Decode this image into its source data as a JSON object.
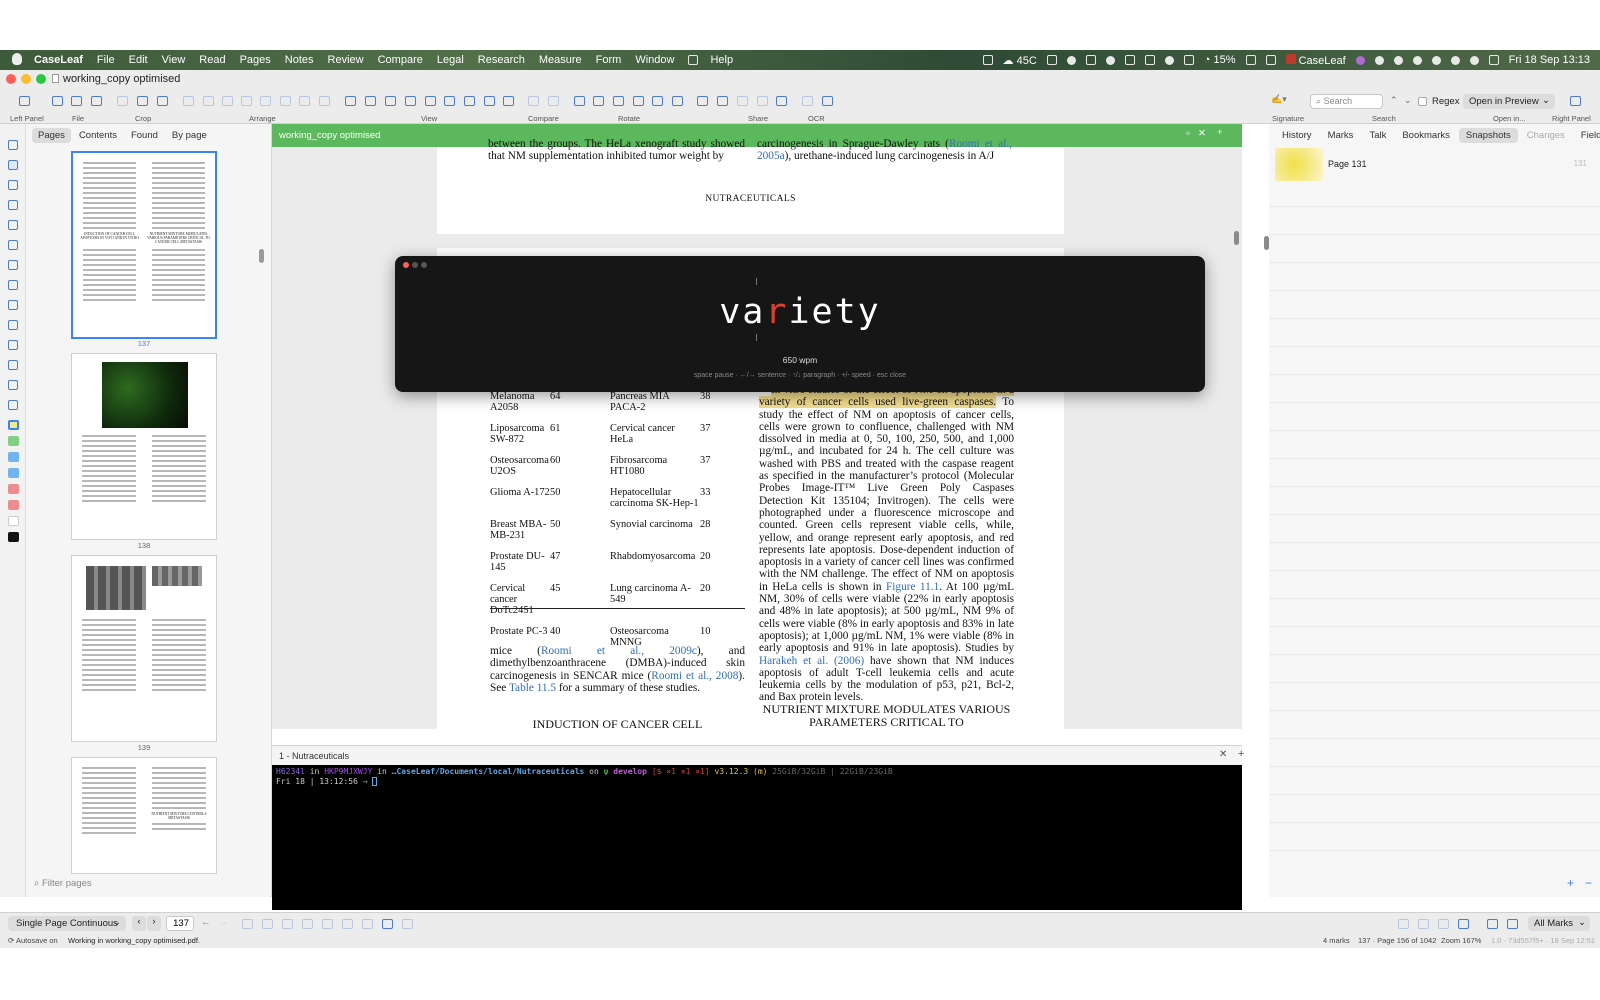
{
  "menubar": {
    "app_name": "CaseLeaf",
    "items": [
      "File",
      "Edit",
      "View",
      "Read",
      "Pages",
      "Notes",
      "Review",
      "Compare",
      "Legal",
      "Research",
      "Measure",
      "Form",
      "Window",
      "Help"
    ],
    "temperature": "45C",
    "battery": "15%",
    "active_app": "CaseLeaf",
    "clock": "Fri 18 Sep  13:13"
  },
  "window": {
    "title": "working_copy optimised"
  },
  "toolbar": {
    "groups": [
      "Left Panel",
      "File",
      "Crop",
      "Arrange",
      "View",
      "Compare",
      "Rotate",
      "Share",
      "OCR",
      "Signature",
      "Search",
      "Open in...",
      "Right Panel"
    ],
    "search_placeholder": "Search",
    "regex_label": "Regex",
    "open_in_label": "Open in Preview"
  },
  "left_panel": {
    "tabs": [
      "Pages",
      "Contents",
      "Found",
      "By page"
    ],
    "active_tab": "Pages",
    "thumbnails": [
      {
        "page": "137",
        "selected": true
      },
      {
        "page": "138",
        "selected": false
      },
      {
        "page": "139",
        "selected": false
      },
      {
        "page": "",
        "selected": false
      }
    ],
    "thumb_headings": {
      "t137_a": "INDUCTION OF CANCER CELL APOPTOSIS IN VIVO AND IN VITRO",
      "t137_b": "NUTRIENT MIXTURE MODULATES VARIOUS PARAMETERS CRITICAL TO CANCER CELL METASTASIS",
      "t140": "NUTRIENT MIXTURE CONTROLS METASTASIS"
    },
    "filter_placeholder": "Filter pages"
  },
  "tool_colors": [
    "#f5e98a",
    "#7fd17f",
    "#6fb4f0",
    "#6fb4f0",
    "#f08c8c",
    "#f08c8c",
    "#ffffff",
    "#111111"
  ],
  "document": {
    "tab_title": "working_copy optimised",
    "top_left": "between the groups. The HeLa xenograft study showed that NM supplementation inhibited tumor weight by",
    "top_right_a": "carcinogenesis in Sprague-Dawley rats (",
    "top_right_link_a": "Roomi et al., 2005a",
    "top_right_b": "), urethane-induced lung carcinogenesis in A/J",
    "footer_heading": "NUTRACEUTICALS",
    "table_rows": [
      [
        "Melanoma A2058",
        "64",
        "Pancreas MIA PACA-2",
        "38"
      ],
      [
        "Liposarcoma SW-872",
        "61",
        "Cervical cancer HeLa",
        "37"
      ],
      [
        "Osteosarcoma U2OS",
        "60",
        "Fibrosarcoma HT1080",
        "37"
      ],
      [
        "Glioma A-172",
        "50",
        "Hepatocellular carcinoma SK-Hep-1",
        "33"
      ],
      [
        "Breast MBA-MB-231",
        "50",
        "Synovial carcinoma",
        "28"
      ],
      [
        "Prostate DU-145",
        "47",
        "Rhabdomyosarcoma",
        "20"
      ],
      [
        "Cervical cancer DoTc2451",
        "45",
        "Lung carcinoma A-549",
        "20"
      ],
      [
        "Prostate PC-3",
        "40",
        "Osteosarcoma MNNG",
        "10"
      ]
    ],
    "left_para": {
      "a": "mice (",
      "l1": "Roomi et al., 2009c",
      "b": "), and dimethylbenzoanthracene (DMBA)-induced skin carcinogenesis in SENCAR mice (",
      "l2": "Roomi et al., 2008",
      "c": "). See ",
      "l3": "Table 11.5",
      "d": " for a summary of these studies."
    },
    "left_heading": "INDUCTION OF CANCER CELL",
    "right_para": {
      "hl": "In vitro studies of the effect of NM on apoptosis in a variety of cancer cells used live-green caspases.",
      "a": " To study the effect of NM on apoptosis of cancer cells, cells were grown to confluence, challenged with NM dissolved in media at 0, 50, 100, 250, 500, and 1,000 µg/mL, and incubated for 24 h. The cell culture was washed with PBS and treated with the caspase reagent as specified in the manufacturer’s protocol (Molecular Probes Image-IT™ Live Green Poly Caspases Detection Kit 135104; Invitrogen). The cells were photographed under a fluorescence microscope and counted. Green cells represent viable cells, while, yellow, and orange represent early apoptosis, and red represents late apoptosis. Dose-dependent induction of apoptosis in a variety of cancer cell lines was confirmed with the NM challenge. The effect of NM on apoptosis in HeLa cells is shown in ",
      "l1": "Figure 11.1",
      "b": ". At 100 µg/mL NM, 30% of cells were viable (22% in early apoptosis and 48% in late apoptosis); at 500 µg/mL, NM 9% of cells were viable (8% in early apoptosis and 83% in late apoptosis); at 1,000 µg/mL NM, 1% were viable (8% in early apoptosis and 91% in late apoptosis). Studies by ",
      "l2": "Harakeh et al. (2006)",
      "c": " have shown that NM induces apoptosis of adult T-cell leukemia cells and acute leukemia cells by the modulation of p53, p21, Bcl-2, and Bax protein levels."
    },
    "right_heading": "NUTRIENT MIXTURE MODULATES VARIOUS PARAMETERS CRITICAL TO"
  },
  "rsvp": {
    "word_pre": "va",
    "word_orp": "r",
    "word_post": "iety",
    "wpm": "650 wpm",
    "hint": "space pause · ←/→ sentence · ↑/↓ paragraph · +/- speed · esc close"
  },
  "terminal": {
    "tab_title": "1 - Nutraceuticals",
    "user": "H6234l",
    "host": "HKP9MJXWJY",
    "path": "…CaseLeaf/Documents/local/Nutraceuticals",
    "branch": "develop",
    "git_status": "[$",
    "marks": "×1   ×1   ×1]",
    "python": "v3.12.3 (m)",
    "mem": "25GiB/32GiB | 22GiB/23GiB",
    "prompt_time": "Fri 18 | 13:12:56"
  },
  "right_panel": {
    "tabs": [
      "History",
      "Marks",
      "Talk",
      "Bookmarks",
      "Snapshots",
      "Changes",
      "Fields"
    ],
    "active_tab": "Snapshots",
    "snapshot_label": "Page 131",
    "snapshot_count": "131"
  },
  "bottom_bar": {
    "view_mode": "Single Page Continuous",
    "page_input": "137",
    "marks_filter": "All Marks"
  },
  "status_bar": {
    "autosave": "Autosave on",
    "working": "Working in working_copy optimised.pdf.",
    "marks": "4 marks",
    "page_info": "137 · Page 156 of 1042",
    "zoom": "Zoom 167%",
    "version": "1.0 · 73d557f5+ · 18 Sep 12:51"
  }
}
